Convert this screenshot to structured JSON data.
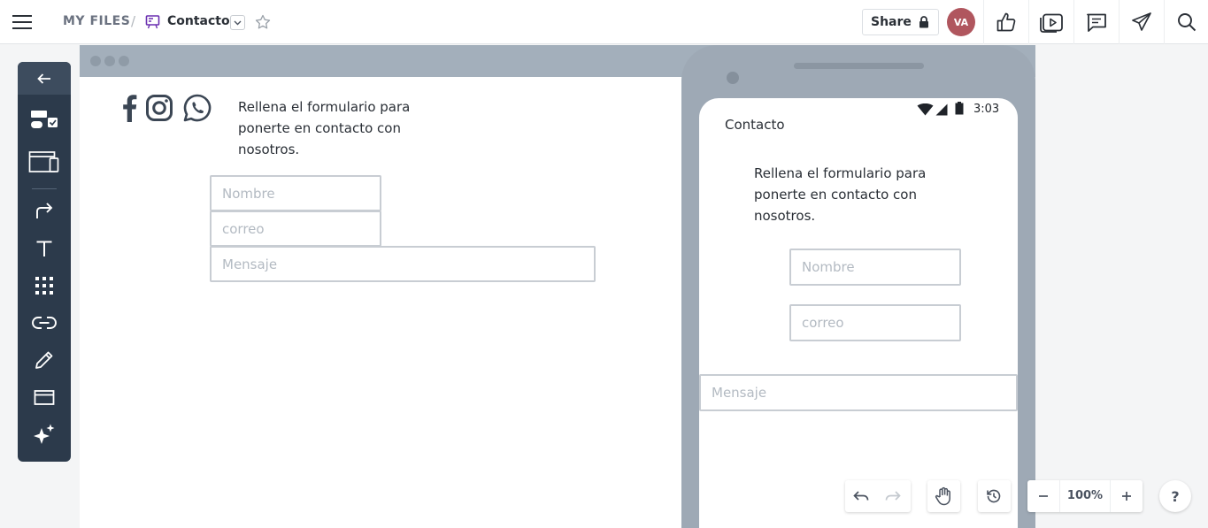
{
  "header": {
    "root": "MY FILES",
    "separator": "/",
    "file_name": "Contacto",
    "share_label": "Share",
    "avatar_initials": "VA"
  },
  "desktop": {
    "description": "Rellena el formulario para ponerte en contacto con nosotros.",
    "name_placeholder": "Nombre",
    "email_placeholder": "correo",
    "message_placeholder": "Mensaje"
  },
  "phone": {
    "time": "3:03",
    "title": "Contacto",
    "description": "Rellena el formulario para ponerte en contacto con nosotros.",
    "name_placeholder": "Nombre",
    "email_placeholder": "correo",
    "message_placeholder": "Mensaje"
  },
  "controls": {
    "zoom": "100%",
    "help": "?"
  },
  "colors": {
    "rail": "#2c3a4b",
    "avatar": "#b0565e",
    "file_icon": "#6a2fb0",
    "frame": "#a3afbb"
  }
}
